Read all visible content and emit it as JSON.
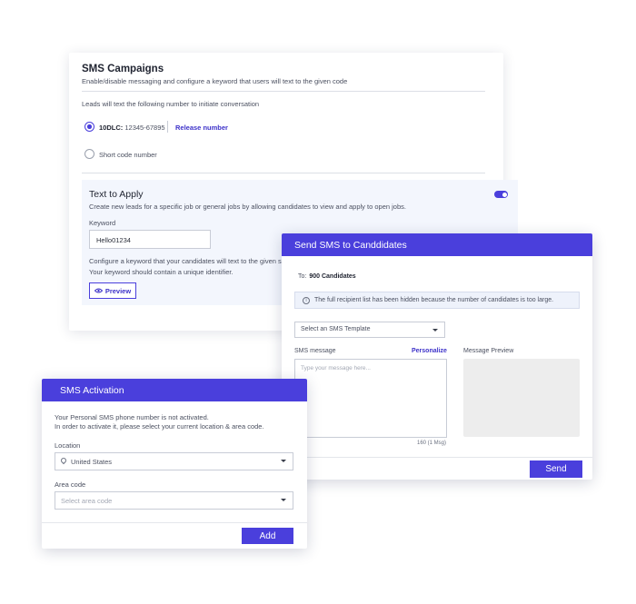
{
  "campaigns": {
    "title": "SMS Campaigns",
    "subtitle": "Enable/disable messaging and configure a keyword that users will text to the given code",
    "lead_text": "Leads will text the following number to initiate conversation",
    "option_10dlc_label": "10DLC:",
    "option_10dlc_number": "12345-67895",
    "release_link": "Release number",
    "option_short_code": "Short code number",
    "selected_option": "10DLC"
  },
  "text_to_apply": {
    "title": "Text to Apply",
    "subtitle": "Create new leads for a specific job or general jobs by allowing candidates to view and apply to open jobs.",
    "enabled": true,
    "keyword_label": "Keyword",
    "keyword_value": "Hello01234",
    "note_line1": "Configure a keyword that your candidates will text to the given sh",
    "note_line2": "Your keyword should contain a unique identifier.",
    "preview_button": "Preview"
  },
  "send_sms": {
    "title": "Send SMS to Canddidates",
    "to_label": "To:",
    "to_value": "900 Candidates",
    "info_text": "The full recipient list has been hidden because the number of candidates is too large.",
    "template_select": "Select an SMS Template",
    "message_label": "SMS message",
    "personalize_link": "Personalize",
    "message_placeholder": "Type your message here...",
    "char_count": "160 (1 Msg)",
    "preview_label": "Message Preview",
    "send_button": "Send"
  },
  "activation": {
    "title": "SMS Activation",
    "line1": "Your Personal SMS phone number is not activated.",
    "line2": "In order to activate it, please select your current location & area code.",
    "location_label": "Location",
    "location_value": "United States",
    "area_code_label": "Area code",
    "area_code_placeholder": "Select area code",
    "add_button": "Add"
  },
  "colors": {
    "accent": "#4a3fdc",
    "link": "#3d32c9",
    "panel_bg": "#f3f6fd",
    "preview_bg": "#ededed"
  }
}
